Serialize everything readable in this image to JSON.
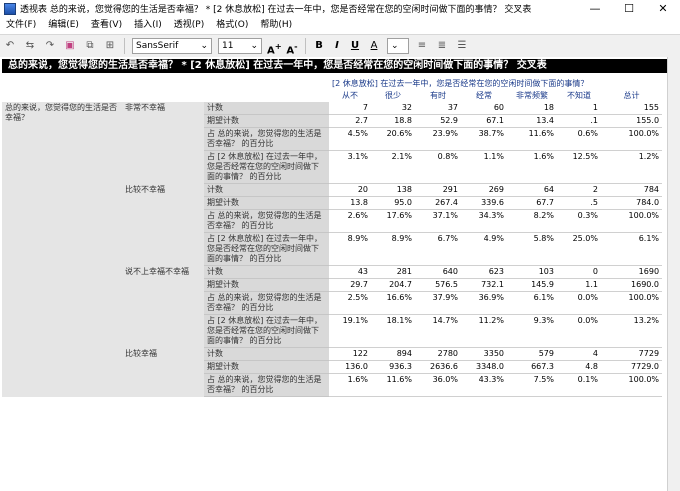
{
  "window": {
    "title": "透视表 总的来说，您觉得您的生活是否幸福？ * [2 休息放松] 在过去一年中，您是否经常在您的空闲时间做下面的事情？ 交叉表",
    "controls": {
      "minimize": "—",
      "maximize": "☐",
      "close": "✕"
    }
  },
  "menu": [
    "文件(F)",
    "编辑(E)",
    "查看(V)",
    "插入(I)",
    "透视(P)",
    "格式(O)",
    "帮助(H)"
  ],
  "toolbar": {
    "font": "SansSerif",
    "size": "11",
    "bold": "B",
    "italic": "I",
    "underline": "U",
    "grow": "A",
    "shrink": "A"
  },
  "table": {
    "title": "总的来说，您觉得您的生活是否幸福？ * [2 休息放松] 在过去一年中，您是否经常在您的空闲时间做下面的事情？ 交叉表",
    "col_var": "[2 休息放松] 在过去一年中，您是否经常在您的空闲时间做下面的事情？",
    "columns": [
      "从不",
      "很少",
      "有时",
      "经常",
      "非常频繁",
      "不知道",
      "总计"
    ],
    "row_var": "总的来说，您觉得您的生活是否幸福？",
    "groups": [
      {
        "label": "非常不幸福",
        "stats": [
          {
            "label": "计数",
            "values": [
              "7",
              "32",
              "37",
              "60",
              "18",
              "1",
              "155"
            ]
          },
          {
            "label": "期望计数",
            "values": [
              "2.7",
              "18.8",
              "52.9",
              "67.1",
              "13.4",
              ".1",
              "155.0"
            ]
          },
          {
            "label": "占 总的来说，您觉得您的生活是否幸福？ 的百分比",
            "values": [
              "4.5%",
              "20.6%",
              "23.9%",
              "38.7%",
              "11.6%",
              "0.6%",
              "100.0%"
            ]
          },
          {
            "label": "占 [2 休息放松] 在过去一年中，您是否经常在您的空闲时间做下面的事情？ 的百分比",
            "values": [
              "3.1%",
              "2.1%",
              "0.8%",
              "1.1%",
              "1.6%",
              "12.5%",
              "1.2%"
            ]
          }
        ]
      },
      {
        "label": "比较不幸福",
        "stats": [
          {
            "label": "计数",
            "values": [
              "20",
              "138",
              "291",
              "269",
              "64",
              "2",
              "784"
            ]
          },
          {
            "label": "期望计数",
            "values": [
              "13.8",
              "95.0",
              "267.4",
              "339.6",
              "67.7",
              ".5",
              "784.0"
            ]
          },
          {
            "label": "占 总的来说，您觉得您的生活是否幸福？ 的百分比",
            "values": [
              "2.6%",
              "17.6%",
              "37.1%",
              "34.3%",
              "8.2%",
              "0.3%",
              "100.0%"
            ]
          },
          {
            "label": "占 [2 休息放松] 在过去一年中，您是否经常在您的空闲时间做下面的事情？ 的百分比",
            "values": [
              "8.9%",
              "8.9%",
              "6.7%",
              "4.9%",
              "5.8%",
              "25.0%",
              "6.1%"
            ]
          }
        ]
      },
      {
        "label": "说不上幸福不幸福",
        "stats": [
          {
            "label": "计数",
            "values": [
              "43",
              "281",
              "640",
              "623",
              "103",
              "0",
              "1690"
            ]
          },
          {
            "label": "期望计数",
            "values": [
              "29.7",
              "204.7",
              "576.5",
              "732.1",
              "145.9",
              "1.1",
              "1690.0"
            ]
          },
          {
            "label": "占 总的来说，您觉得您的生活是否幸福？ 的百分比",
            "values": [
              "2.5%",
              "16.6%",
              "37.9%",
              "36.9%",
              "6.1%",
              "0.0%",
              "100.0%"
            ]
          },
          {
            "label": "占 [2 休息放松] 在过去一年中，您是否经常在您的空闲时间做下面的事情？ 的百分比",
            "values": [
              "19.1%",
              "18.1%",
              "14.7%",
              "11.2%",
              "9.3%",
              "0.0%",
              "13.2%"
            ]
          }
        ]
      },
      {
        "label": "比较幸福",
        "stats": [
          {
            "label": "计数",
            "values": [
              "122",
              "894",
              "2780",
              "3350",
              "579",
              "4",
              "7729"
            ]
          },
          {
            "label": "期望计数",
            "values": [
              "136.0",
              "936.3",
              "2636.6",
              "3348.0",
              "667.3",
              "4.8",
              "7729.0"
            ]
          },
          {
            "label": "占 总的来说，您觉得您的生活是否幸福？ 的百分比",
            "values": [
              "1.6%",
              "11.6%",
              "36.0%",
              "43.3%",
              "7.5%",
              "0.1%",
              "100.0%"
            ]
          }
        ]
      }
    ]
  }
}
